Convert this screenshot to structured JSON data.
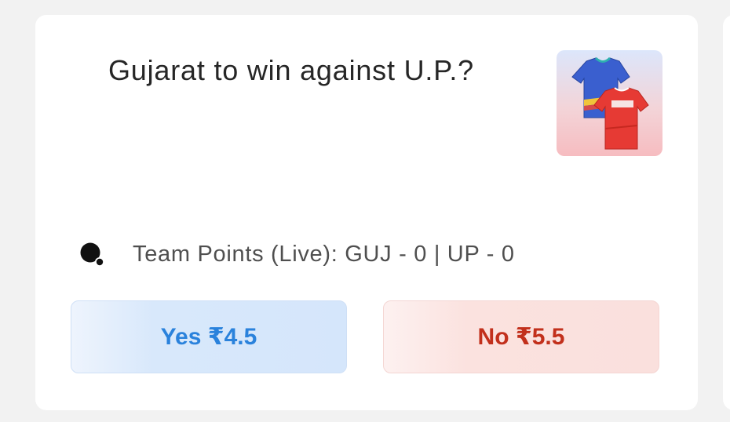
{
  "market": {
    "question": "Gujarat to win against U.P.?",
    "thumbnail_icon": "team-jerseys-icon",
    "status_icon": "live-score-icon",
    "status_text": "Team Points (Live): GUJ - 0 | UP - 0"
  },
  "actions": {
    "yes_label": "Yes ₹4.5",
    "no_label": "No ₹5.5"
  },
  "colors": {
    "yes_text": "#2a82dc",
    "no_text": "#c2301c",
    "background": "#f2f2f2",
    "card": "#ffffff"
  }
}
